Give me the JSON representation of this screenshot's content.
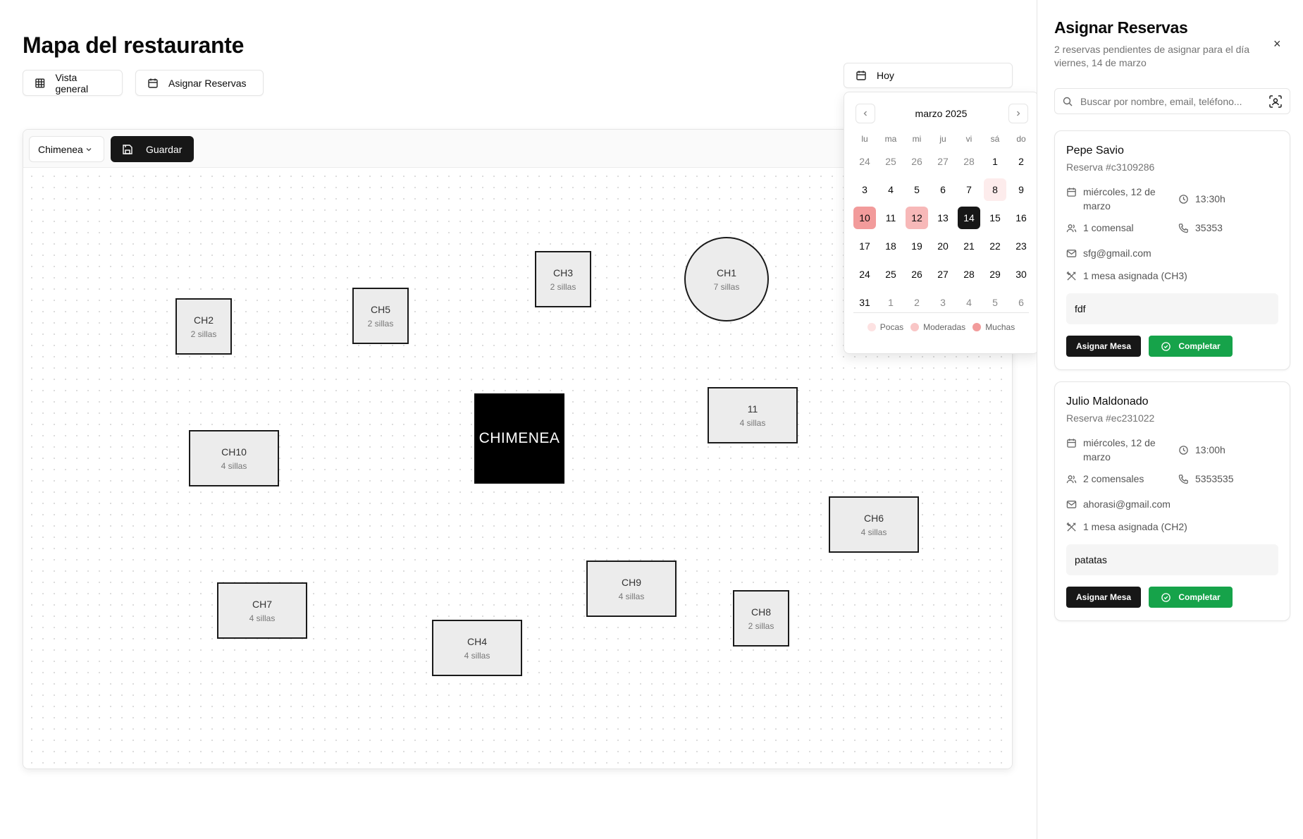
{
  "header": {
    "title": "Mapa del restaurante",
    "overview_label": "Vista general",
    "assign_label": "Asignar Reservas"
  },
  "date_picker": {
    "value": "Hoy",
    "month_label": "marzo 2025",
    "weekdays": [
      "lu",
      "ma",
      "mi",
      "ju",
      "vi",
      "sá",
      "do"
    ],
    "weeks": [
      [
        {
          "d": "24",
          "out": true
        },
        {
          "d": "25",
          "out": true
        },
        {
          "d": "26",
          "out": true
        },
        {
          "d": "27",
          "out": true
        },
        {
          "d": "28",
          "out": true
        },
        {
          "d": "1"
        },
        {
          "d": "2"
        }
      ],
      [
        {
          "d": "3"
        },
        {
          "d": "4"
        },
        {
          "d": "5"
        },
        {
          "d": "6"
        },
        {
          "d": "7"
        },
        {
          "d": "8",
          "level": "few"
        },
        {
          "d": "9"
        }
      ],
      [
        {
          "d": "10",
          "level": "many"
        },
        {
          "d": "11"
        },
        {
          "d": "12",
          "level": "mod"
        },
        {
          "d": "13"
        },
        {
          "d": "14",
          "selected": true
        },
        {
          "d": "15"
        },
        {
          "d": "16"
        }
      ],
      [
        {
          "d": "17"
        },
        {
          "d": "18"
        },
        {
          "d": "19"
        },
        {
          "d": "20"
        },
        {
          "d": "21"
        },
        {
          "d": "22"
        },
        {
          "d": "23"
        }
      ],
      [
        {
          "d": "24"
        },
        {
          "d": "25"
        },
        {
          "d": "26"
        },
        {
          "d": "27"
        },
        {
          "d": "28"
        },
        {
          "d": "29"
        },
        {
          "d": "30"
        }
      ],
      [
        {
          "d": "31"
        },
        {
          "d": "1",
          "out": true
        },
        {
          "d": "2",
          "out": true
        },
        {
          "d": "3",
          "out": true
        },
        {
          "d": "4",
          "out": true
        },
        {
          "d": "5",
          "out": true
        },
        {
          "d": "6",
          "out": true
        }
      ]
    ],
    "legend": [
      {
        "label": "Pocas",
        "color": "#fde2e2"
      },
      {
        "label": "Moderadas",
        "color": "#f9c6c6"
      },
      {
        "label": "Muchas",
        "color": "#f29b9b"
      }
    ]
  },
  "editor": {
    "zone": "Chimenea",
    "save_label": "Guardar",
    "fireplace_label": "CHIMENEA",
    "tables": [
      {
        "name": "CH2",
        "capacity": "2 sillas"
      },
      {
        "name": "CH5",
        "capacity": "2 sillas"
      },
      {
        "name": "CH3",
        "capacity": "2 sillas"
      },
      {
        "name": "CH1",
        "capacity": "7 sillas"
      },
      {
        "name": "11",
        "capacity": "4 sillas"
      },
      {
        "name": "CH10",
        "capacity": "4 sillas"
      },
      {
        "name": "CH6",
        "capacity": "4 sillas"
      },
      {
        "name": "CH9",
        "capacity": "4 sillas"
      },
      {
        "name": "CH7",
        "capacity": "4 sillas"
      },
      {
        "name": "CH8",
        "capacity": "2 sillas"
      },
      {
        "name": "CH4",
        "capacity": "4 sillas"
      }
    ]
  },
  "panel": {
    "title": "Asignar Reservas",
    "subtitle": "2 reservas pendientes de asignar para el día viernes, 14 de marzo",
    "close_icon": "×",
    "search_placeholder": "Buscar por nombre, email, teléfono...",
    "reservations": [
      {
        "name": "Pepe Savio",
        "id": "Reserva #c3109286",
        "date": "miércoles, 12 de marzo",
        "time": "13:30h",
        "guests": "1 comensal",
        "phone": "35353",
        "email": "sfg@gmail.com",
        "tables": "1 mesa asignada (CH3)",
        "note": "fdf",
        "assign_label": "Asignar Mesa",
        "complete_label": "Completar"
      },
      {
        "name": "Julio Maldonado",
        "id": "Reserva #ec231022",
        "date": "miércoles, 12 de marzo",
        "time": "13:00h",
        "guests": "2 comensales",
        "phone": "5353535",
        "email": "ahorasi@gmail.com",
        "tables": "1 mesa asignada (CH2)",
        "note": "patatas",
        "assign_label": "Asignar Mesa",
        "complete_label": "Completar"
      }
    ]
  }
}
